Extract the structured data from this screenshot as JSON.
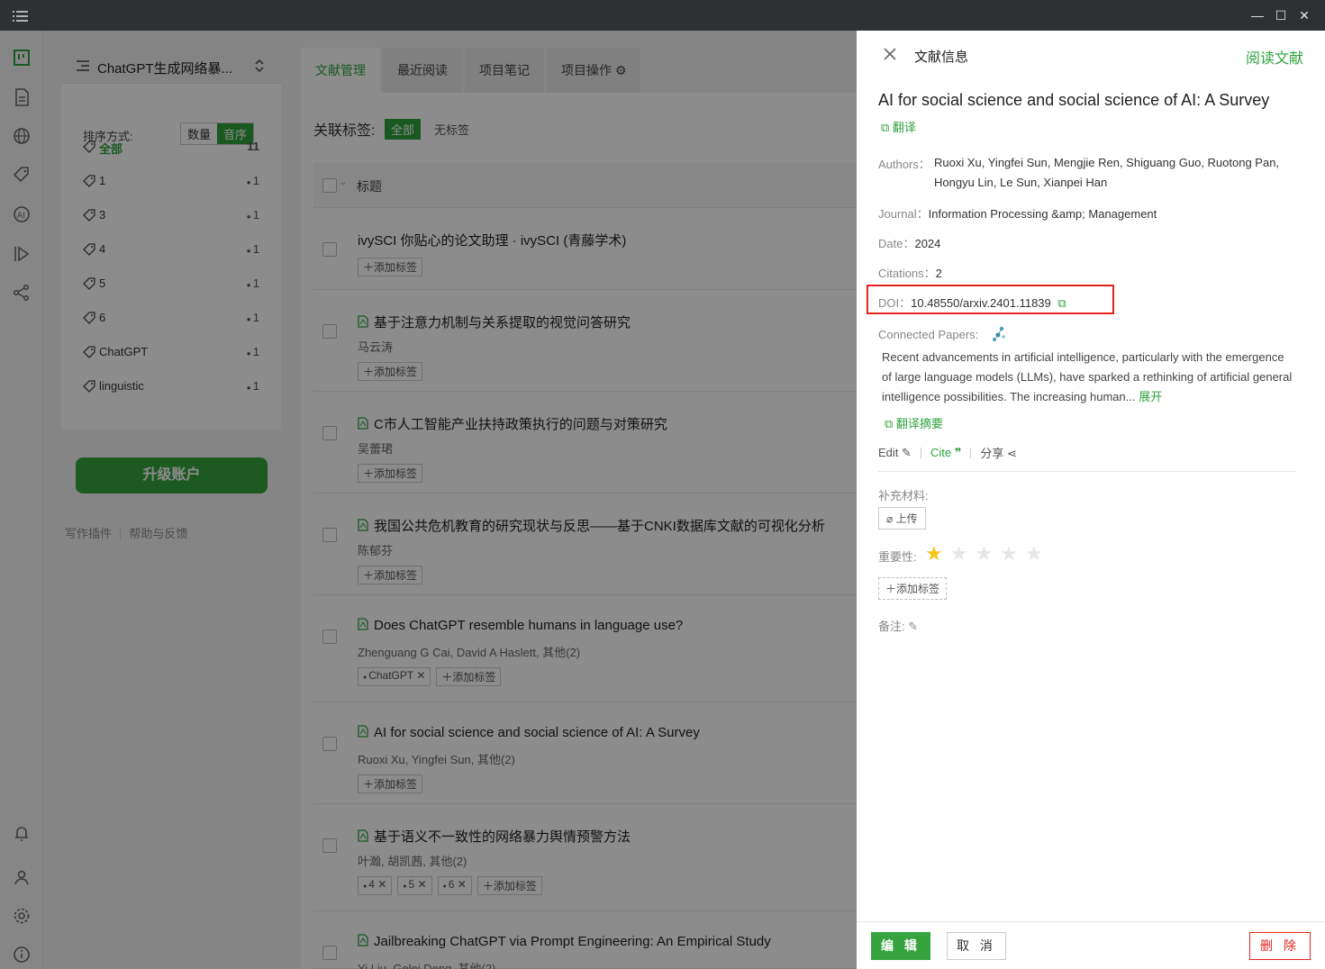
{
  "colors": {
    "accent": "#2fa33d",
    "danger": "#e8231e",
    "titlebar": "#2f3033"
  },
  "project": {
    "name": "ChatGPT生成网络暴..."
  },
  "sort": {
    "label": "排序方式:",
    "options": [
      "数量",
      "音序"
    ],
    "selected": "音序"
  },
  "tags": [
    {
      "label": "全部",
      "count": "11"
    },
    {
      "label": "1",
      "count": "1"
    },
    {
      "label": "3",
      "count": "1"
    },
    {
      "label": "4",
      "count": "1"
    },
    {
      "label": "5",
      "count": "1"
    },
    {
      "label": "6",
      "count": "1"
    },
    {
      "label": "ChatGPT",
      "count": "1"
    },
    {
      "label": "linguistic",
      "count": "1"
    }
  ],
  "upgrade_label": "升级账户",
  "footer_links": [
    "写作插件",
    "帮助与反馈"
  ],
  "tabs": [
    "文献管理",
    "最近阅读",
    "项目笔记",
    "项目操作"
  ],
  "filter": {
    "label": "关联标签:",
    "all": "全部",
    "none": "无标签"
  },
  "table": {
    "header": "标题",
    "add_tag": "添加标签"
  },
  "rows": [
    {
      "title": "ivySCI 你贴心的论文助理 · ivySCI (青藤学术)",
      "authors": "",
      "pdf": false,
      "tags": []
    },
    {
      "title": "基于注意力机制与关系提取的视觉问答研究",
      "authors": "马云涛",
      "pdf": true,
      "tags": []
    },
    {
      "title": "C市人工智能产业扶持政策执行的问题与对策研究",
      "authors": "吴蕾珺",
      "pdf": true,
      "tags": []
    },
    {
      "title": "我国公共危机教育的研究现状与反思——基于CNKI数据库文献的可视化分析",
      "authors": "陈郁芬",
      "pdf": true,
      "tags": []
    },
    {
      "title": "Does ChatGPT resemble humans in language use?",
      "authors": "Zhenguang G Cai, David A Haslett, 其他(2)",
      "pdf": true,
      "tags": [
        "ChatGPT"
      ]
    },
    {
      "title": "AI for social science and social science of AI: A Survey",
      "authors": "Ruoxi Xu, Yingfei Sun, 其他(2)",
      "pdf": true,
      "tags": []
    },
    {
      "title": "基于语义不一致性的网络暴力舆情预警方法",
      "authors": "叶瀚, 胡凯茜, 其他(2)",
      "pdf": true,
      "tags": [
        "4",
        "5",
        "6"
      ]
    },
    {
      "title": "Jailbreaking ChatGPT via Prompt Engineering: An Empirical Study",
      "authors": "Yi Liu, Gelei Deng, 其他(2)",
      "pdf": true,
      "tags": []
    }
  ],
  "panel": {
    "header": "文献信息",
    "read_label": "阅读文献",
    "title": "AI for social science and social science of AI: A Survey",
    "translate": "翻译",
    "authors_label": "Authors：",
    "authors": "Ruoxi Xu, Yingfei Sun, Mengjie Ren, Shiguang Guo, Ruotong Pan, Hongyu Lin, Le Sun, Xianpei Han",
    "journal_label": "Journal：",
    "journal": "Information Processing &amp; Management",
    "date_label": "Date：",
    "date": "2024",
    "citations_label": "Citations：",
    "citations": "2",
    "doi_label": "DOI：",
    "doi": "10.48550/arxiv.2401.11839",
    "connected_label": "Connected Papers:",
    "abstract": "Recent advancements in artificial intelligence, particularly with the emergence of large language models (LLMs), have sparked a rethinking of artificial general intelligence possibilities. The increasing human...",
    "expand": "展开",
    "translate_abstract": "翻译摘要",
    "edit": "Edit",
    "cite": "Cite",
    "share": "分享",
    "supplement_label": "补充材料:",
    "upload": "上传",
    "importance_label": "重要性:",
    "importance": 1,
    "importance_max": 5,
    "add_tag": "添加标签",
    "note_label": "备注:",
    "btn_edit": "编 辑",
    "btn_cancel": "取 消",
    "btn_delete": "删 除"
  }
}
